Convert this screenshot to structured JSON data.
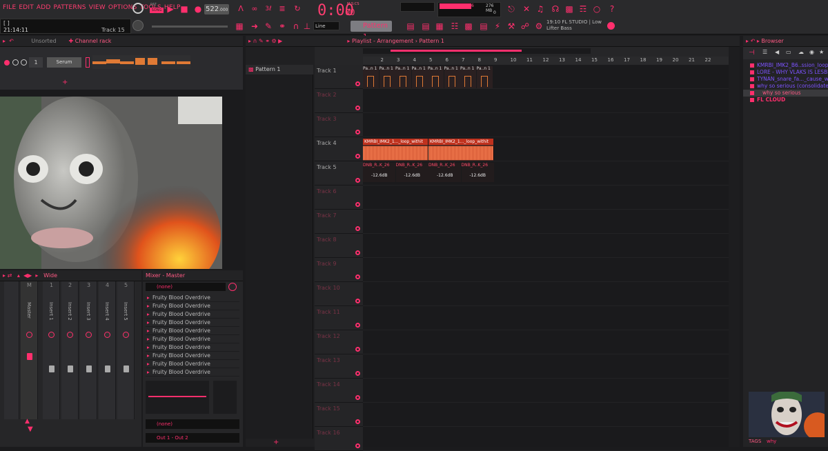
{
  "menu": [
    "FILE",
    "EDIT",
    "ADD",
    "PATTERNS",
    "VIEW",
    "OPTIONS",
    "TOOLS",
    "HELP"
  ],
  "hint": {
    "time": "21:14:11",
    "track": "Track 15",
    "bracket": "[ ]"
  },
  "transport": {
    "tempo": "522",
    "tempo_dec": ".000",
    "time": "0:00",
    "time_sub": "00",
    "msc": "M:S:CS",
    "pat_label": "PAT",
    "song_label": "SONG"
  },
  "cpu": {
    "mem": "276 MB",
    "voices": "0",
    "peak": "6"
  },
  "snap": "Line",
  "pattern_selector": "Pattern 1",
  "news": {
    "line1": "19:10  FL STUDIO | Low",
    "line2": "Lifter Bass"
  },
  "channel_rack": {
    "title": "Channel rack",
    "filter": "Unsorted",
    "channel_num": "1",
    "channel_name": "Serum"
  },
  "mixer": {
    "header": "Wide",
    "strips": [
      {
        "num": "",
        "label": "Master",
        "top": "M"
      },
      {
        "num": "1",
        "label": "Insert 1"
      },
      {
        "num": "2",
        "label": "Insert 2"
      },
      {
        "num": "3",
        "label": "Insert 3"
      },
      {
        "num": "4",
        "label": "Insert 4"
      },
      {
        "num": "5",
        "label": "Insert 5"
      }
    ]
  },
  "mixer_master": {
    "title": "Mixer - Master",
    "input": "(none)",
    "effects": [
      "Fruity Blood Overdrive",
      "Fruity Blood Overdrive",
      "Fruity Blood Overdrive",
      "Fruity Blood Overdrive",
      "Fruity Blood Overdrive",
      "Fruity Blood Overdrive",
      "Fruity Blood Overdrive",
      "Fruity Blood Overdrive",
      "Fruity Blood Overdrive",
      "Fruity Blood Overdrive"
    ],
    "send": "(none)",
    "output": "Out 1 - Out 2"
  },
  "playlist": {
    "breadcrumb": "Playlist - Arrangement › Pattern 1",
    "pattern_item": "Pattern 1",
    "ruler": [
      "2",
      "3",
      "4",
      "5",
      "6",
      "7",
      "8",
      "9",
      "10",
      "11",
      "12",
      "13",
      "14",
      "15",
      "16",
      "17",
      "18",
      "19",
      "20",
      "21",
      "22"
    ],
    "tracks": [
      "Track 1",
      "Track 2",
      "Track 3",
      "Track 4",
      "Track 5",
      "Track 6",
      "Track 7",
      "Track 8",
      "Track 9",
      "Track 10",
      "Track 11",
      "Track 12",
      "Track 13",
      "Track 14",
      "Track 15",
      "Track 16"
    ],
    "clips": {
      "pattern": [
        "Pa..n 1",
        "Pa..n 1",
        "Pa..n 1",
        "Pa..n 1",
        "Pa..n 1",
        "Pa..n 1",
        "Pa..n 1",
        "Pa..n 1"
      ],
      "audio": [
        "KMRBI_IMK2_1..._loop_withit",
        "KMRBI_IMK2_1..._loop_withit"
      ],
      "auto": [
        "DNB_R..K_26",
        "DNB_R..K_26",
        "DNB_R..K_26",
        "DNB_R..K_26"
      ],
      "gain": [
        "-12.6dB",
        "-12.6dB",
        "-12.6dB",
        "-12.6dB"
      ]
    }
  },
  "browser": {
    "title": "Browser",
    "items": [
      "KMRBI_IMK2_B6..ssion_loop_why",
      "LORE - WHY VLAKS IS LESBIAN",
      "TYNAN_snare_fa..._cause_why_not",
      "why so serious (consolidated)",
      "why so serious"
    ],
    "cloud": "FL CLOUD",
    "tags_label": "TAGS",
    "tag_value": "why"
  },
  "colors": {
    "accent": "#ff2f6d",
    "panel": "#262628",
    "bg": "#1b1b1d",
    "browser_text": "#7d53ff",
    "audio_clip": "#ff7b4a"
  }
}
